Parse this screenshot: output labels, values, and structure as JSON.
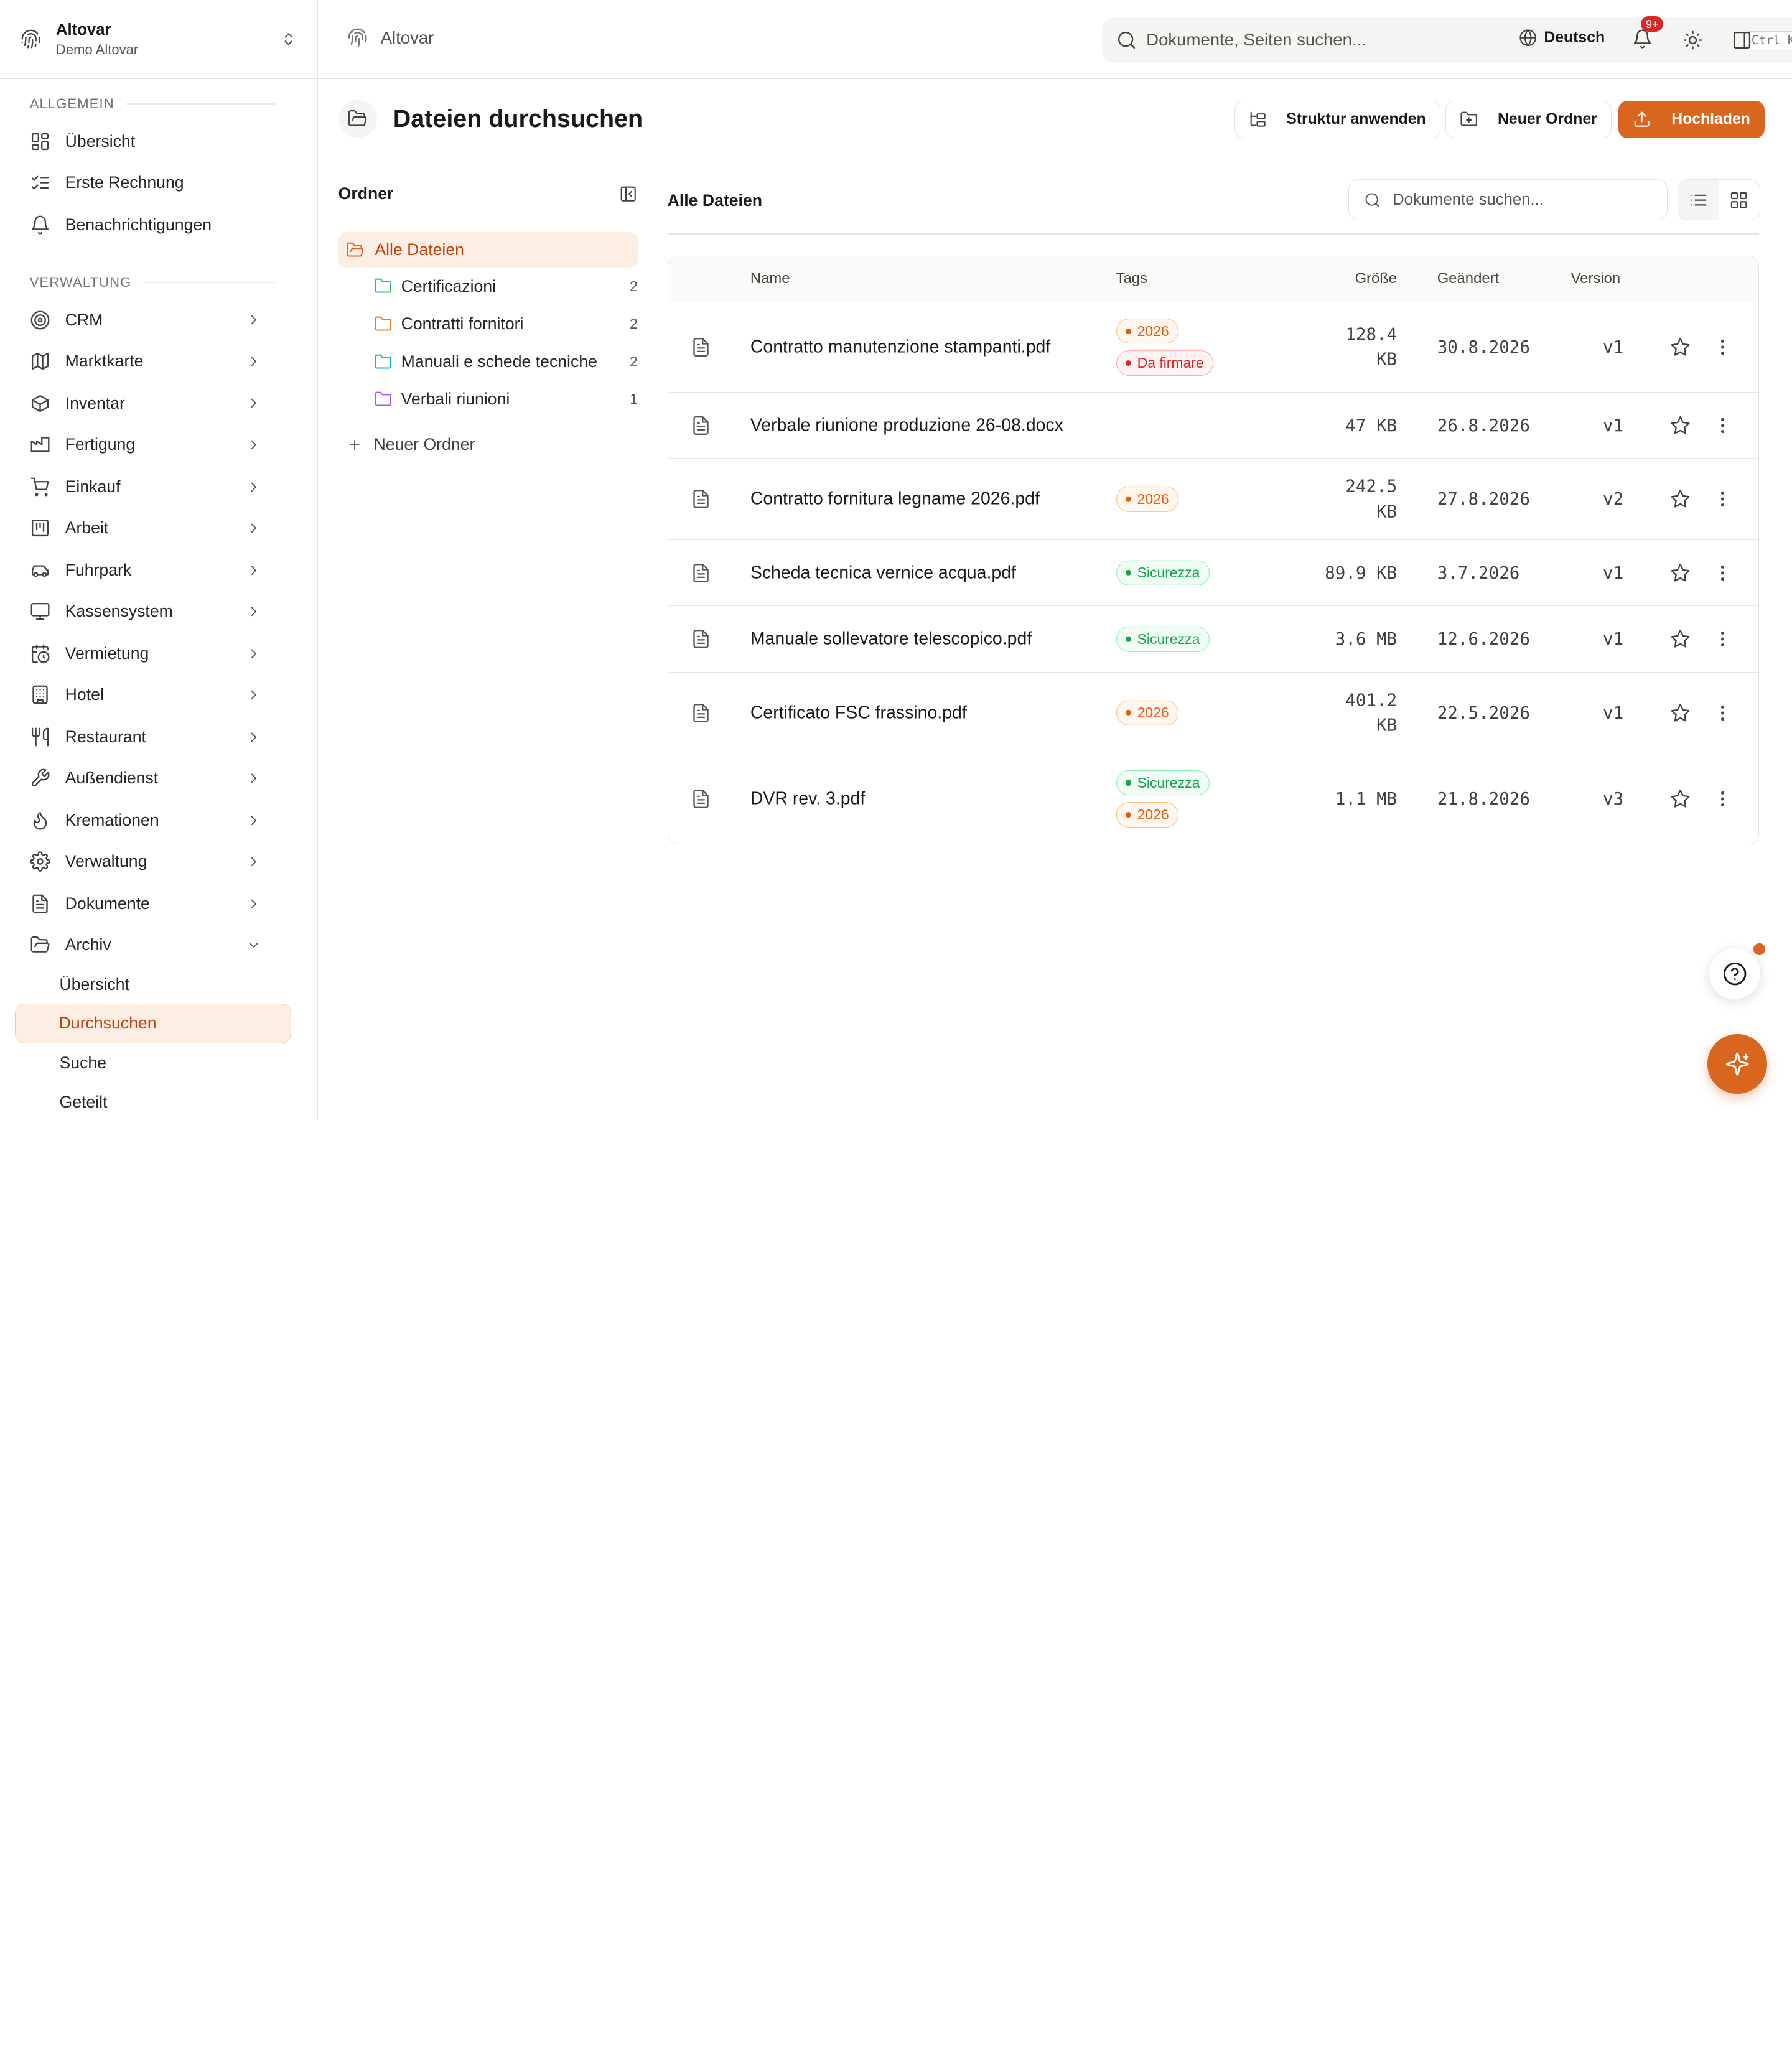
{
  "org": {
    "name": "Altovar",
    "subtitle": "Demo Altovar"
  },
  "sidebar": {
    "section_general": "ALLGEMEIN",
    "general_items": [
      {
        "label": "Übersicht",
        "icon": "dashboard-icon"
      },
      {
        "label": "Erste Rechnung",
        "icon": "checklist-icon"
      },
      {
        "label": "Benachrichtigungen",
        "icon": "bell-icon"
      }
    ],
    "section_admin": "VERWALTUNG",
    "admin_items": [
      {
        "label": "CRM",
        "icon": "target-icon"
      },
      {
        "label": "Marktkarte",
        "icon": "map-icon"
      },
      {
        "label": "Inventar",
        "icon": "package-icon"
      },
      {
        "label": "Fertigung",
        "icon": "factory-icon"
      },
      {
        "label": "Einkauf",
        "icon": "cart-icon"
      },
      {
        "label": "Arbeit",
        "icon": "kanban-icon"
      },
      {
        "label": "Fuhrpark",
        "icon": "car-icon"
      },
      {
        "label": "Kassensystem",
        "icon": "monitor-icon"
      },
      {
        "label": "Vermietung",
        "icon": "calendar-clock-icon"
      },
      {
        "label": "Hotel",
        "icon": "building-icon"
      },
      {
        "label": "Restaurant",
        "icon": "utensils-icon"
      },
      {
        "label": "Außendienst",
        "icon": "wrench-icon"
      },
      {
        "label": "Kremationen",
        "icon": "flame-icon"
      },
      {
        "label": "Verwaltung",
        "icon": "settings-icon"
      },
      {
        "label": "Dokumente",
        "icon": "file-text-icon"
      },
      {
        "label": "Archiv",
        "icon": "folder-open-icon"
      }
    ],
    "archive_sub": [
      "Übersicht",
      "Durchsuchen",
      "Suche",
      "Geteilt"
    ]
  },
  "topbar": {
    "breadcrumb": "Altovar",
    "search_placeholder": "Dokumente, Seiten suchen...",
    "shortcut": "Ctrl K",
    "language": "Deutsch",
    "notifications_badge": "9+"
  },
  "page": {
    "title": "Dateien durchsuchen",
    "btn_structure": "Struktur anwenden",
    "btn_new_folder": "Neuer Ordner",
    "btn_upload": "Hochladen",
    "accent": "#d9661f"
  },
  "folders": {
    "title": "Ordner",
    "all": "Alle Dateien",
    "items": [
      {
        "label": "Certificazioni",
        "count": "2",
        "color": "#22c55e"
      },
      {
        "label": "Contratti fornitori",
        "count": "2",
        "color": "#f97316"
      },
      {
        "label": "Manuali e schede tecniche",
        "count": "2",
        "color": "#06b6d4"
      },
      {
        "label": "Verbali riunioni",
        "count": "1",
        "color": "#a855f7"
      }
    ],
    "new_folder": "Neuer Ordner"
  },
  "files": {
    "title": "Alle Dateien",
    "search_placeholder": "Dokumente suchen...",
    "columns": {
      "name": "Name",
      "tags": "Tags",
      "size": "Größe",
      "modified": "Geändert",
      "version": "Version"
    },
    "rows": [
      {
        "name": "Contratto manutenzione stampanti.pdf",
        "tags": [
          {
            "label": "2026",
            "kind": "orange"
          },
          {
            "label": "Da firmare",
            "kind": "red"
          }
        ],
        "size": [
          "128.4",
          "KB"
        ],
        "modified": "30.8.2026",
        "version": "v1"
      },
      {
        "name": "Verbale riunione produzione 26-08.docx",
        "tags": [],
        "size": [
          "47 KB"
        ],
        "modified": "26.8.2026",
        "version": "v1"
      },
      {
        "name": "Contratto fornitura legname 2026.pdf",
        "tags": [
          {
            "label": "2026",
            "kind": "orange"
          }
        ],
        "size": [
          "242.5",
          "KB"
        ],
        "modified": "27.8.2026",
        "version": "v2"
      },
      {
        "name": "Scheda tecnica vernice acqua.pdf",
        "tags": [
          {
            "label": "Sicurezza",
            "kind": "green"
          }
        ],
        "size": [
          "89.9 KB"
        ],
        "modified": "3.7.2026",
        "version": "v1"
      },
      {
        "name": "Manuale sollevatore telescopico.pdf",
        "tags": [
          {
            "label": "Sicurezza",
            "kind": "green"
          }
        ],
        "size": [
          "3.6 MB"
        ],
        "modified": "12.6.2026",
        "version": "v1"
      },
      {
        "name": "Certificato FSC frassino.pdf",
        "tags": [
          {
            "label": "2026",
            "kind": "orange"
          }
        ],
        "size": [
          "401.2",
          "KB"
        ],
        "modified": "22.5.2026",
        "version": "v1"
      },
      {
        "name": "DVR rev. 3.pdf",
        "tags": [
          {
            "label": "Sicurezza",
            "kind": "green"
          },
          {
            "label": "2026",
            "kind": "orange"
          }
        ],
        "size": [
          "1.1 MB"
        ],
        "modified": "21.8.2026",
        "version": "v3"
      }
    ]
  },
  "tag_colors": {
    "orange": {
      "text": "#ea580c",
      "border": "#fdba74",
      "bg": "#fff7ed"
    },
    "red": {
      "text": "#dc2626",
      "border": "#fca5a5",
      "bg": "#fef2f2"
    },
    "green": {
      "text": "#16a34a",
      "border": "#86efac",
      "bg": "#f0fdf4"
    }
  }
}
